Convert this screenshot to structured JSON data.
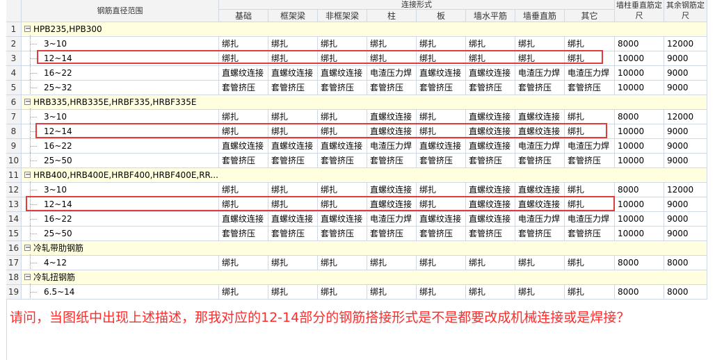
{
  "headers": {
    "range": "钢筋直径范围",
    "connection_group": "连接形式",
    "columns": [
      "基础",
      "框架梁",
      "非框架梁",
      "柱",
      "板",
      "墙水平筋",
      "墙垂直筋",
      "其它"
    ],
    "wall_col_length": "墙柱垂直筋定尺",
    "other_length": "其余钢筋定尺"
  },
  "rows": [
    {
      "n": "1",
      "type": "group",
      "label": "HPB235,HPB300"
    },
    {
      "n": "2",
      "type": "data",
      "label": "3~10",
      "conn": [
        "绑扎",
        "绑扎",
        "绑扎",
        "绑扎",
        "绑扎",
        "绑扎",
        "绑扎",
        "绑扎"
      ],
      "len1": "8000",
      "len2": "12000"
    },
    {
      "n": "3",
      "type": "data",
      "label": "12~14",
      "conn": [
        "绑扎",
        "绑扎",
        "绑扎",
        "绑扎",
        "绑扎",
        "绑扎",
        "绑扎",
        "绑扎"
      ],
      "len1": "10000",
      "len2": "9000"
    },
    {
      "n": "4",
      "type": "data",
      "label": "16~22",
      "conn": [
        "直螺纹连接",
        "直螺纹连接",
        "直螺纹连接",
        "电渣压力焊",
        "直螺纹连接",
        "直螺纹连接",
        "电渣压力焊",
        "电渣压力焊"
      ],
      "len1": "10000",
      "len2": "9000"
    },
    {
      "n": "5",
      "type": "data",
      "label": "25~32",
      "conn": [
        "套管挤压",
        "套管挤压",
        "套管挤压",
        "套管挤压",
        "套管挤压",
        "套管挤压",
        "套管挤压",
        "套管挤压"
      ],
      "len1": "10000",
      "len2": "9000"
    },
    {
      "n": "6",
      "type": "group",
      "label": "HRB335,HRB335E,HRBF335,HRBF335E"
    },
    {
      "n": "7",
      "type": "data",
      "label": "3~10",
      "conn": [
        "绑扎",
        "绑扎",
        "绑扎",
        "直螺纹连接",
        "绑扎",
        "直螺纹连接",
        "直螺纹连接",
        "绑扎"
      ],
      "len1": "8000",
      "len2": "12000"
    },
    {
      "n": "8",
      "type": "data",
      "label": "12~14",
      "conn": [
        "绑扎",
        "绑扎",
        "绑扎",
        "直螺纹连接",
        "绑扎",
        "直螺纹连接",
        "直螺纹连接",
        "绑扎"
      ],
      "len1": "10000",
      "len2": "9000"
    },
    {
      "n": "9",
      "type": "data",
      "label": "16~22",
      "conn": [
        "直螺纹连接",
        "直螺纹连接",
        "直螺纹连接",
        "电渣压力焊",
        "直螺纹连接",
        "直螺纹连接",
        "电渣压力焊",
        "电渣压力焊"
      ],
      "len1": "10000",
      "len2": "9000"
    },
    {
      "n": "10",
      "type": "data",
      "label": "25~50",
      "conn": [
        "套管挤压",
        "套管挤压",
        "套管挤压",
        "套管挤压",
        "套管挤压",
        "套管挤压",
        "套管挤压",
        "套管挤压"
      ],
      "len1": "10000",
      "len2": "9000"
    },
    {
      "n": "11",
      "type": "group",
      "label": "HRB400,HRB400E,HRBF400,HRBF400E,RR..."
    },
    {
      "n": "12",
      "type": "data",
      "label": "3~10",
      "conn": [
        "绑扎",
        "绑扎",
        "绑扎",
        "直螺纹连接",
        "绑扎",
        "直螺纹连接",
        "直螺纹连接",
        "绑扎"
      ],
      "len1": "8000",
      "len2": "12000"
    },
    {
      "n": "13",
      "type": "data",
      "label": "12~14",
      "conn": [
        "绑扎",
        "绑扎",
        "绑扎",
        "直螺纹连接",
        "绑扎",
        "直螺纹连接",
        "直螺纹连接",
        "绑扎"
      ],
      "len1": "10000",
      "len2": "9000"
    },
    {
      "n": "14",
      "type": "data",
      "label": "16~22",
      "conn": [
        "直螺纹连接",
        "直螺纹连接",
        "直螺纹连接",
        "电渣压力焊",
        "直螺纹连接",
        "直螺纹连接",
        "电渣压力焊",
        "电渣压力焊"
      ],
      "len1": "10000",
      "len2": "9000"
    },
    {
      "n": "15",
      "type": "data",
      "label": "25~50",
      "conn": [
        "套管挤压",
        "套管挤压",
        "套管挤压",
        "套管挤压",
        "套管挤压",
        "套管挤压",
        "套管挤压",
        "套管挤压"
      ],
      "len1": "10000",
      "len2": "9000"
    },
    {
      "n": "16",
      "type": "group",
      "label": "冷轧带肋钢筋"
    },
    {
      "n": "17",
      "type": "data",
      "label": "4~12",
      "conn": [
        "绑扎",
        "绑扎",
        "绑扎",
        "绑扎",
        "绑扎",
        "绑扎",
        "绑扎",
        "绑扎"
      ],
      "len1": "8000",
      "len2": "8000"
    },
    {
      "n": "18",
      "type": "group",
      "label": "冷轧扭钢筋"
    },
    {
      "n": "19",
      "type": "data",
      "label": "6.5~14",
      "conn": [
        "绑扎",
        "绑扎",
        "绑扎",
        "绑扎",
        "绑扎",
        "绑扎",
        "绑扎",
        "绑扎"
      ],
      "len1": "8000",
      "len2": "8000"
    }
  ],
  "toggle_symbol": "−",
  "question": "请问，当图纸中出现上述描述，那我对应的12-14部分的钢筋搭接形式是不是都要改成机械连接或是焊接？",
  "colors": {
    "highlight": "#e03c3c",
    "group_bg": "#ffffe0",
    "header_bg": "#f3f3f3",
    "question": "#ff2b2b"
  }
}
